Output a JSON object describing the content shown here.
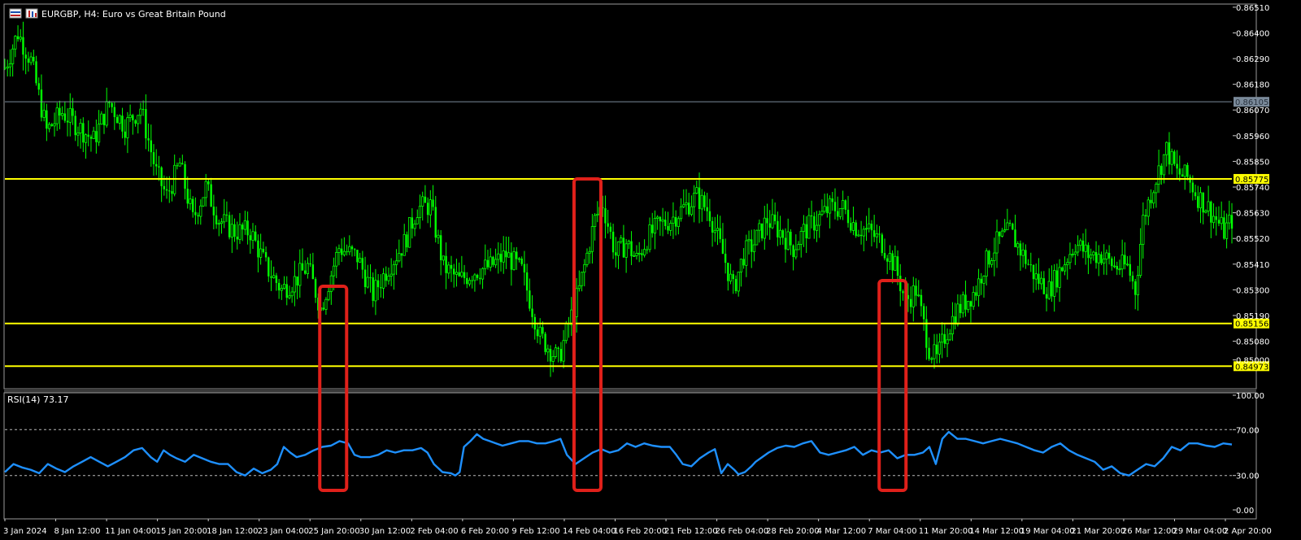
{
  "header": {
    "title": "EURGBP, H4:  Euro vs Great Britain Pound"
  },
  "indicator": {
    "label": "RSI(14) 73.17"
  },
  "colors": {
    "background": "#000000",
    "candles": "#00ff00",
    "support_resistance": "#ffff00",
    "rsi_line": "#1e90ff",
    "highlight_box": "#e0201a",
    "axis_text": "#ffffff",
    "current_price_line": "#7a8a9a"
  },
  "chart_data": [
    {
      "type": "candlestick",
      "title": "EURGBP, H4:  Euro vs Great Britain Pound",
      "ylim": [
        0.8488,
        0.8652
      ],
      "y_ticks": [
        "0.86510",
        "0.86400",
        "0.86290",
        "0.86180",
        "0.86070",
        "0.85960",
        "0.85850",
        "0.85740",
        "0.85630",
        "0.85520",
        "0.85410",
        "0.85300",
        "0.85190",
        "0.85080",
        "0.85000"
      ],
      "x_ticks": [
        "3 Jan 2024",
        "8 Jan 12:00",
        "11 Jan 04:00",
        "15 Jan 20:00",
        "18 Jan 12:00",
        "23 Jan 04:00",
        "25 Jan 20:00",
        "30 Jan 12:00",
        "2 Feb 04:00",
        "6 Feb 20:00",
        "9 Feb 12:00",
        "14 Feb 04:00",
        "16 Feb 20:00",
        "21 Feb 12:00",
        "26 Feb 04:00",
        "28 Feb 20:00",
        "4 Mar 12:00",
        "7 Mar 04:00",
        "11 Mar 20:00",
        "14 Mar 12:00",
        "19 Mar 04:00",
        "21 Mar 20:00",
        "26 Mar 12:00",
        "29 Mar 04:00",
        "2 Apr 20:00"
      ],
      "horizontal_levels": [
        {
          "value": 0.85775,
          "label": "0.85775"
        },
        {
          "value": 0.85156,
          "label": "0.85156"
        },
        {
          "value": 0.84973,
          "label": "0.84973"
        }
      ],
      "current_price": {
        "value": 0.86105,
        "label": "0.86105"
      },
      "close_path": [
        [
          0,
          0.8625
        ],
        [
          5,
          0.864
        ],
        [
          10,
          0.8628
        ],
        [
          16,
          0.8598
        ],
        [
          22,
          0.8606
        ],
        [
          28,
          0.86
        ],
        [
          34,
          0.8594
        ],
        [
          40,
          0.861
        ],
        [
          46,
          0.86
        ],
        [
          52,
          0.8608
        ],
        [
          58,
          0.858
        ],
        [
          62,
          0.857
        ],
        [
          67,
          0.8584
        ],
        [
          72,
          0.856
        ],
        [
          77,
          0.8574
        ],
        [
          82,
          0.856
        ],
        [
          88,
          0.8555
        ],
        [
          94,
          0.8555
        ],
        [
          100,
          0.854
        ],
        [
          106,
          0.853
        ],
        [
          111,
          0.8534
        ],
        [
          116,
          0.854
        ],
        [
          121,
          0.8522
        ],
        [
          128,
          0.8548
        ],
        [
          135,
          0.8544
        ],
        [
          141,
          0.8528
        ],
        [
          147,
          0.854
        ],
        [
          153,
          0.855
        ],
        [
          158,
          0.8565
        ],
        [
          163,
          0.8566
        ],
        [
          168,
          0.854
        ],
        [
          174,
          0.8534
        ],
        [
          180,
          0.8538
        ],
        [
          186,
          0.854
        ],
        [
          192,
          0.8545
        ],
        [
          198,
          0.8538
        ],
        [
          205,
          0.851
        ],
        [
          212,
          0.85
        ],
        [
          216,
          0.8515
        ],
        [
          220,
          0.853
        ],
        [
          223,
          0.8545
        ],
        [
          226,
          0.856
        ],
        [
          229,
          0.8567
        ],
        [
          231,
          0.8558
        ],
        [
          234,
          0.8545
        ],
        [
          238,
          0.855
        ],
        [
          242,
          0.8543
        ],
        [
          246,
          0.8552
        ],
        [
          250,
          0.8557
        ],
        [
          255,
          0.856
        ],
        [
          260,
          0.8565
        ],
        [
          265,
          0.857
        ],
        [
          270,
          0.8563
        ],
        [
          273,
          0.8552
        ],
        [
          276,
          0.8542
        ],
        [
          279,
          0.853
        ],
        [
          283,
          0.8545
        ],
        [
          287,
          0.855
        ],
        [
          292,
          0.856
        ],
        [
          297,
          0.8555
        ],
        [
          302,
          0.8548
        ],
        [
          306,
          0.8555
        ],
        [
          311,
          0.856
        ],
        [
          316,
          0.8565
        ],
        [
          321,
          0.8565
        ],
        [
          326,
          0.8557
        ],
        [
          331,
          0.8555
        ],
        [
          336,
          0.855
        ],
        [
          341,
          0.854
        ],
        [
          345,
          0.8525
        ],
        [
          349,
          0.853
        ],
        [
          354,
          0.8505
        ],
        [
          357,
          0.85
        ],
        [
          360,
          0.851
        ],
        [
          364,
          0.852
        ],
        [
          368,
          0.8525
        ],
        [
          372,
          0.853
        ],
        [
          375,
          0.854
        ],
        [
          380,
          0.855
        ],
        [
          385,
          0.8555
        ],
        [
          390,
          0.8545
        ],
        [
          395,
          0.8535
        ],
        [
          400,
          0.853
        ],
        [
          405,
          0.854
        ],
        [
          410,
          0.855
        ],
        [
          415,
          0.8545
        ],
        [
          420,
          0.8545
        ],
        [
          425,
          0.854
        ],
        [
          430,
          0.854
        ],
        [
          433,
          0.853
        ],
        [
          436,
          0.856
        ],
        [
          440,
          0.8575
        ],
        [
          445,
          0.859
        ],
        [
          449,
          0.858
        ],
        [
          453,
          0.8578
        ],
        [
          457,
          0.857
        ],
        [
          461,
          0.8565
        ],
        [
          464,
          0.856
        ],
        [
          467,
          0.8555
        ],
        [
          470,
          0.856
        ]
      ],
      "highlight_boxes": [
        {
          "x_start": "25 Jan 20:00",
          "x_end": "30 Jan 12:00"
        },
        {
          "x_start": "14 Feb 04:00",
          "x_end": "16 Feb 20:00"
        },
        {
          "x_start": "7 Mar 04:00",
          "x_end": "11 Mar 20:00"
        }
      ]
    },
    {
      "type": "line",
      "title": "RSI(14) 73.17",
      "ylim": [
        0,
        100
      ],
      "y_ticks": [
        "100.00",
        "70.00",
        "30.00",
        "0.00"
      ],
      "levels": [
        70,
        30
      ],
      "series": [
        {
          "values_path": [
            [
              0,
              33
            ],
            [
              4,
              40
            ],
            [
              8,
              37
            ],
            [
              12,
              35
            ],
            [
              16,
              32
            ],
            [
              20,
              40
            ],
            [
              24,
              36
            ],
            [
              28,
              33
            ],
            [
              32,
              38
            ],
            [
              36,
              42
            ],
            [
              40,
              46
            ],
            [
              44,
              42
            ],
            [
              48,
              38
            ],
            [
              52,
              42
            ],
            [
              56,
              46
            ],
            [
              60,
              52
            ],
            [
              64,
              54
            ],
            [
              68,
              46
            ],
            [
              71,
              42
            ],
            [
              74,
              52
            ],
            [
              77,
              48
            ],
            [
              80,
              45
            ],
            [
              84,
              42
            ],
            [
              88,
              48
            ],
            [
              92,
              45
            ],
            [
              96,
              42
            ],
            [
              100,
              40
            ],
            [
              104,
              40
            ],
            [
              108,
              33
            ],
            [
              112,
              30
            ],
            [
              116,
              36
            ],
            [
              120,
              32
            ],
            [
              124,
              35
            ],
            [
              127,
              40
            ],
            [
              130,
              55
            ],
            [
              133,
              50
            ],
            [
              136,
              46
            ],
            [
              140,
              48
            ],
            [
              144,
              52
            ],
            [
              148,
              55
            ],
            [
              152,
              56
            ],
            [
              156,
              60
            ],
            [
              160,
              58
            ],
            [
              163,
              48
            ],
            [
              166,
              46
            ],
            [
              170,
              46
            ],
            [
              174,
              48
            ],
            [
              178,
              52
            ],
            [
              182,
              50
            ],
            [
              186,
              52
            ],
            [
              190,
              52
            ],
            [
              194,
              54
            ],
            [
              197,
              50
            ],
            [
              200,
              40
            ],
            [
              204,
              33
            ],
            [
              208,
              32
            ],
            [
              210,
              30
            ],
            [
              212,
              33
            ],
            [
              214,
              55
            ],
            [
              217,
              60
            ],
            [
              220,
              66
            ],
            [
              223,
              62
            ],
            [
              226,
              60
            ],
            [
              229,
              58
            ],
            [
              232,
              56
            ],
            [
              236,
              58
            ],
            [
              240,
              60
            ],
            [
              244,
              60
            ],
            [
              248,
              58
            ],
            [
              252,
              58
            ],
            [
              256,
              60
            ],
            [
              259,
              62
            ],
            [
              262,
              48
            ],
            [
              266,
              40
            ],
            [
              270,
              45
            ],
            [
              274,
              50
            ],
            [
              278,
              53
            ],
            [
              282,
              50
            ],
            [
              286,
              52
            ],
            [
              290,
              58
            ],
            [
              294,
              55
            ],
            [
              298,
              58
            ],
            [
              302,
              56
            ],
            [
              306,
              55
            ],
            [
              310,
              55
            ],
            [
              313,
              48
            ],
            [
              316,
              40
            ],
            [
              320,
              38
            ],
            [
              324,
              45
            ],
            [
              328,
              50
            ],
            [
              331,
              53
            ],
            [
              334,
              32
            ],
            [
              337,
              40
            ],
            [
              340,
              35
            ],
            [
              342,
              31
            ],
            [
              345,
              33
            ],
            [
              348,
              38
            ],
            [
              350,
              42
            ],
            [
              353,
              46
            ],
            [
              356,
              50
            ],
            [
              360,
              54
            ],
            [
              364,
              56
            ],
            [
              368,
              55
            ],
            [
              372,
              58
            ],
            [
              376,
              60
            ],
            [
              380,
              50
            ],
            [
              384,
              48
            ],
            [
              388,
              50
            ],
            [
              392,
              52
            ],
            [
              396,
              55
            ],
            [
              400,
              48
            ],
            [
              404,
              52
            ],
            [
              408,
              50
            ],
            [
              412,
              52
            ],
            [
              416,
              45
            ],
            [
              420,
              48
            ],
            [
              424,
              48
            ],
            [
              428,
              50
            ],
            [
              431,
              55
            ],
            [
              434,
              40
            ],
            [
              437,
              62
            ],
            [
              440,
              68
            ],
            [
              444,
              62
            ],
            [
              448,
              62
            ],
            [
              452,
              60
            ],
            [
              456,
              58
            ],
            [
              460,
              60
            ],
            [
              464,
              62
            ],
            [
              468,
              60
            ],
            [
              472,
              58
            ],
            [
              476,
              55
            ],
            [
              480,
              52
            ],
            [
              484,
              50
            ],
            [
              488,
              55
            ],
            [
              492,
              58
            ],
            [
              496,
              52
            ],
            [
              500,
              48
            ],
            [
              504,
              45
            ],
            [
              508,
              42
            ],
            [
              512,
              35
            ],
            [
              516,
              38
            ],
            [
              520,
              32
            ],
            [
              524,
              30
            ],
            [
              528,
              35
            ],
            [
              532,
              40
            ],
            [
              536,
              38
            ],
            [
              540,
              45
            ],
            [
              544,
              55
            ],
            [
              548,
              52
            ],
            [
              552,
              58
            ],
            [
              556,
              58
            ],
            [
              560,
              56
            ],
            [
              564,
              55
            ],
            [
              568,
              58
            ],
            [
              572,
              57
            ]
          ]
        }
      ]
    }
  ]
}
